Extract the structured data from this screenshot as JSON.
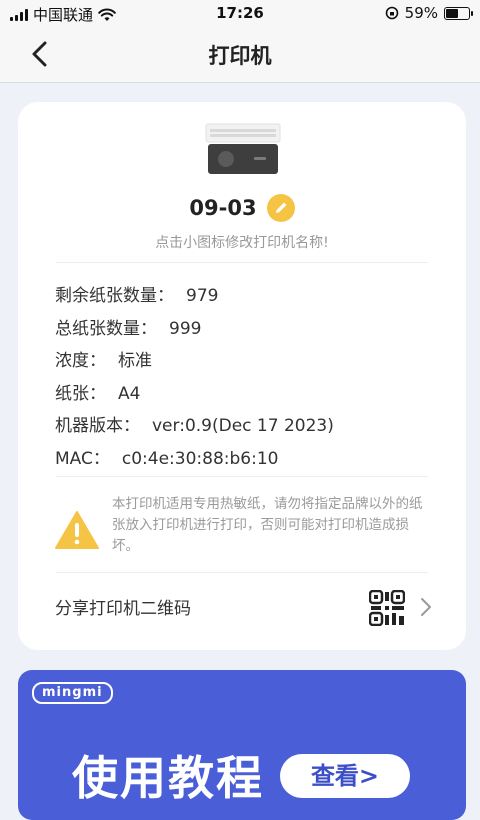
{
  "status": {
    "carrier": "中国联通",
    "time": "17:26",
    "battery_pct": "59%",
    "battery_level": 0.59
  },
  "nav": {
    "title": "打印机"
  },
  "printer": {
    "name": "09-03",
    "hint": "点击小图标修改打印机名称!"
  },
  "info": [
    {
      "label": "剩余纸张数量：",
      "value": "979"
    },
    {
      "label": "总纸张数量：",
      "value": "999"
    },
    {
      "label": "浓度：",
      "value": "标准"
    },
    {
      "label": "纸张：",
      "value": "A4"
    },
    {
      "label": "机器版本：",
      "value": "ver:0.9(Dec 17 2023)"
    },
    {
      "label": "MAC：",
      "value": "c0:4e:30:88:b6:10"
    }
  ],
  "warning": {
    "text": "本打印机适用专用热敏纸，请勿将指定品牌以外的纸张放入打印机进行打印，否则可能对打印机造成损坏。"
  },
  "share": {
    "label": "分享打印机二维码"
  },
  "banner": {
    "logo": "mingmi",
    "title": "使用教程",
    "button": "查看>"
  },
  "colors": {
    "accent": "#f6c445",
    "banner": "#4a5ed8",
    "background": "#eef2f8"
  },
  "icons": [
    "back-arrow-icon",
    "wifi-icon",
    "signal-icon",
    "battery-icon",
    "orientation-lock-icon",
    "printer-icon",
    "pencil-icon",
    "warning-icon",
    "qr-code-icon",
    "chevron-right-icon"
  ]
}
